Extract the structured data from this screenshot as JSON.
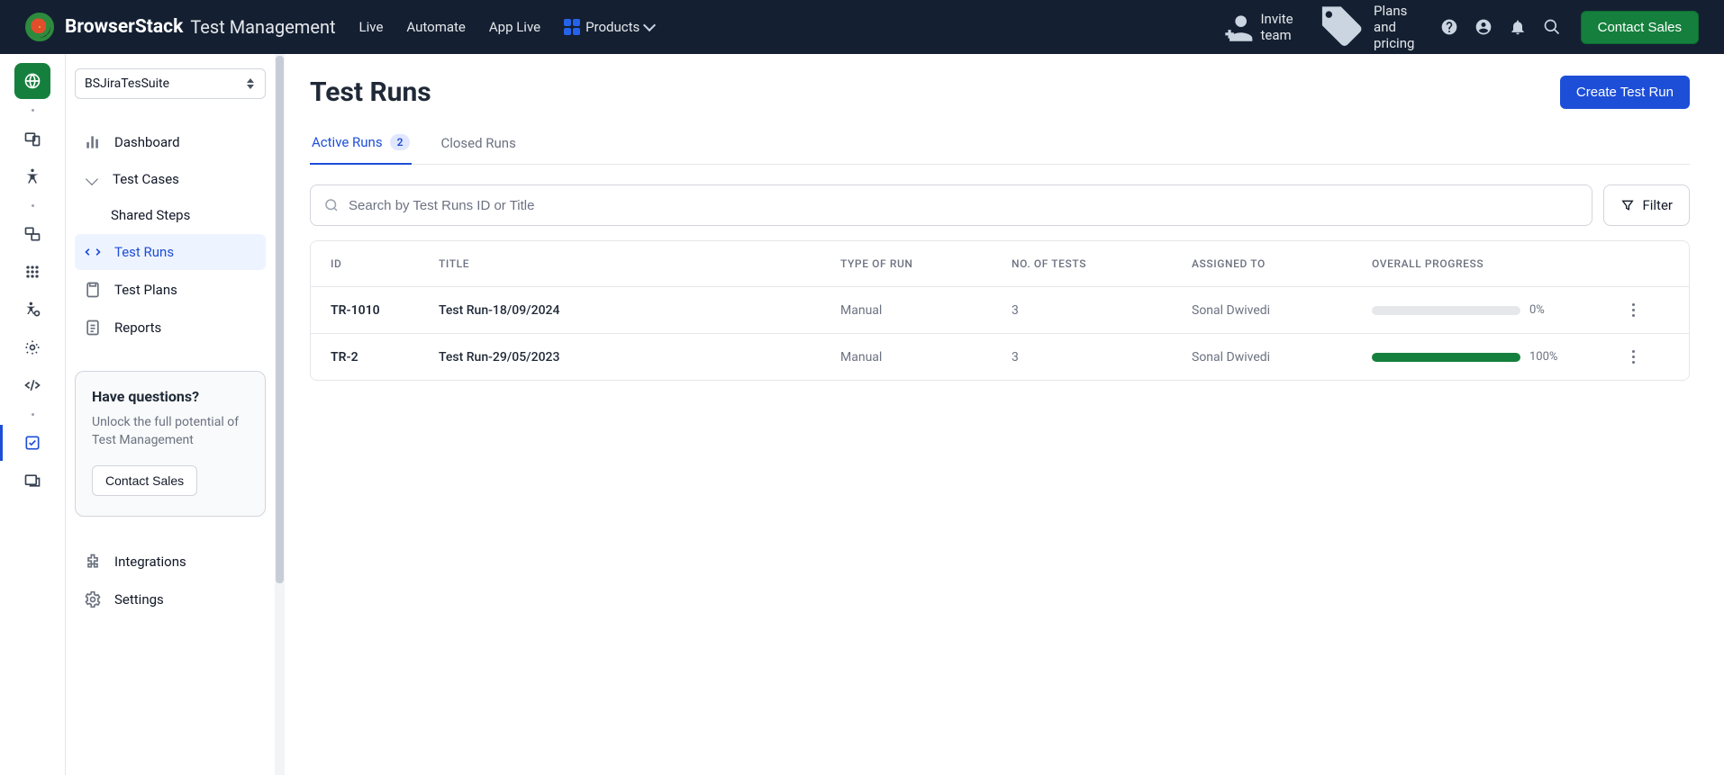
{
  "brand": {
    "name": "BrowserStack",
    "suffix": "Test Management"
  },
  "topnav": {
    "links": [
      "Live",
      "Automate",
      "App Live"
    ],
    "products": "Products",
    "invite": "Invite team",
    "plans": "Plans and pricing",
    "contact": "Contact Sales"
  },
  "suite_selected": "BSJiraTesSuite",
  "sidenav": {
    "dashboard": "Dashboard",
    "testcases": "Test Cases",
    "shared_steps": "Shared Steps",
    "testruns": "Test Runs",
    "testplans": "Test Plans",
    "reports": "Reports",
    "integrations": "Integrations",
    "settings": "Settings"
  },
  "help": {
    "title": "Have questions?",
    "body": "Unlock the full potential of Test Management",
    "cta": "Contact Sales"
  },
  "page": {
    "title": "Test Runs",
    "create_btn": "Create Test Run",
    "tabs": {
      "active": "Active Runs",
      "active_count": "2",
      "closed": "Closed Runs"
    },
    "search_placeholder": "Search by Test Runs ID or Title",
    "filter_label": "Filter",
    "columns": {
      "id": "ID",
      "title": "TITLE",
      "type": "TYPE OF RUN",
      "tests": "NO. OF TESTS",
      "assigned": "ASSIGNED TO",
      "progress": "OVERALL PROGRESS"
    },
    "rows": [
      {
        "id": "TR-1010",
        "title": "Test Run-18/09/2024",
        "type": "Manual",
        "tests": "3",
        "assigned": "Sonal Dwivedi",
        "progress_pct": 0,
        "progress_label": "0%"
      },
      {
        "id": "TR-2",
        "title": "Test Run-29/05/2023",
        "type": "Manual",
        "tests": "3",
        "assigned": "Sonal Dwivedi",
        "progress_pct": 100,
        "progress_label": "100%"
      }
    ]
  }
}
